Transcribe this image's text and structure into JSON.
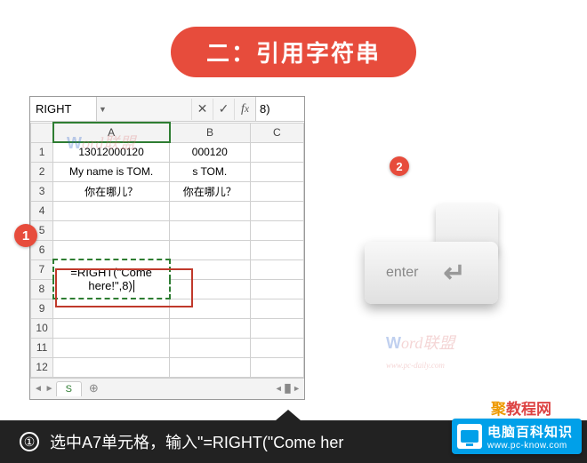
{
  "title": "二：引用字符串",
  "excel": {
    "namebox": "RIGHT",
    "formula_bar": "8)",
    "columns": [
      "A",
      "B",
      "C"
    ],
    "rows": [
      "1",
      "2",
      "3",
      "4",
      "5",
      "6",
      "7",
      "8",
      "9",
      "10",
      "11",
      "12"
    ],
    "cells": {
      "a1": "13012000120",
      "b1": "000120",
      "a2": "My name is TOM.",
      "b2": "s TOM.",
      "a3": "你在哪儿？",
      "b3": "你在哪儿？",
      "a7a8": "=RIGHT(\"Come here!\",8)"
    },
    "sheet_tab": "S"
  },
  "steps": {
    "s1": "1",
    "s2": "2"
  },
  "enter_key": "enter",
  "watermark_site": "www.pc-daily.com",
  "footer": {
    "num": "①",
    "text": "选中A7单元格，输入\"=RIGHT(\"Come her"
  },
  "sitebadge": {
    "title": "电脑百科知识",
    "url": "www.pc-know.com"
  },
  "ju": "聚教程网"
}
